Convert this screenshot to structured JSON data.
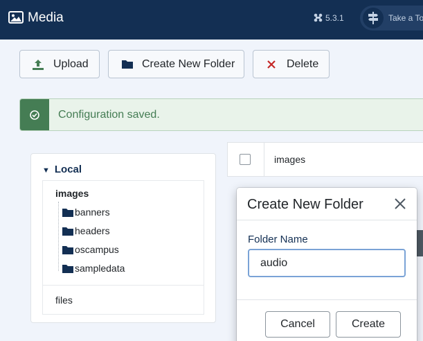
{
  "header": {
    "title": "Media",
    "version": "5.3.1",
    "tour_label": "Take a Tour",
    "icons": [
      "image-icon",
      "joomla-icon",
      "signpost-icon"
    ]
  },
  "toolbar": {
    "upload_label": "Upload",
    "new_folder_label": "Create New Folder",
    "delete_label": "Delete"
  },
  "alert": {
    "message": "Configuration saved."
  },
  "tree": {
    "root_label": "Local",
    "folder_label": "images",
    "children": [
      "banners",
      "headers",
      "oscampus",
      "sampledata"
    ],
    "files_label": "files"
  },
  "list": {
    "rows": [
      {
        "name": "images"
      }
    ]
  },
  "modal": {
    "title": "Create New Folder",
    "field_label": "Folder Name",
    "field_value": "audio",
    "cancel_label": "Cancel",
    "create_label": "Create"
  },
  "colors": {
    "header_bg": "#132f53",
    "success": "#457d54",
    "link": "#132f53",
    "focus_border": "#7aa3d6"
  }
}
